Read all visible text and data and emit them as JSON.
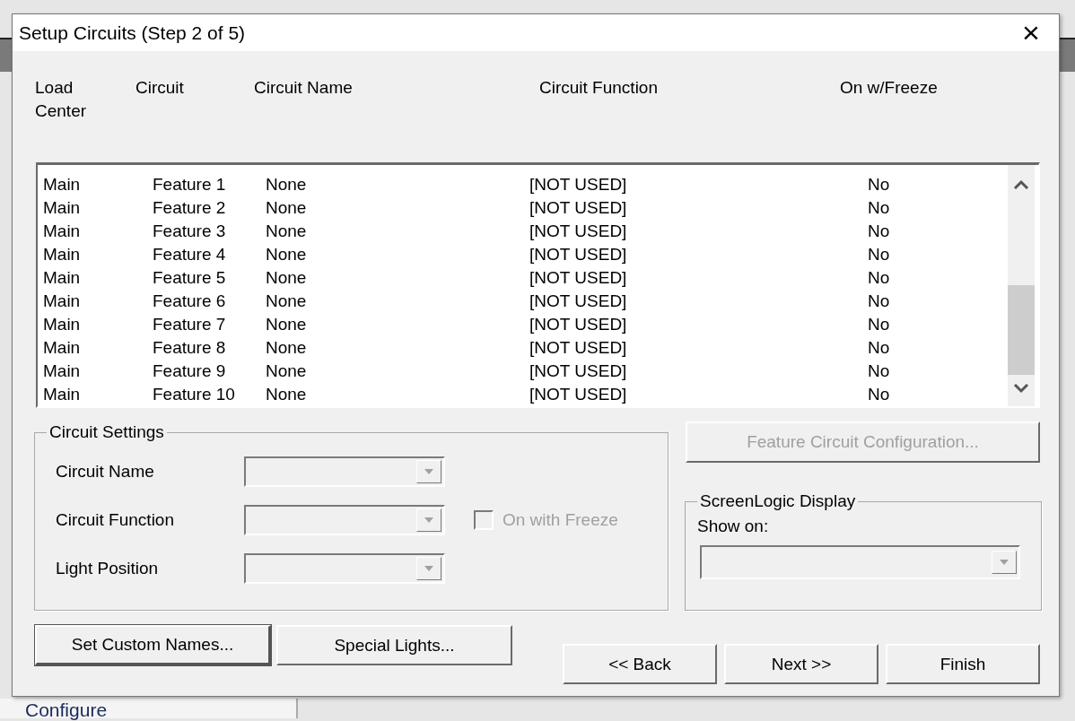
{
  "background": {
    "bottom_text": "Configure"
  },
  "dialog": {
    "title": "Setup Circuits (Step 2 of 5)",
    "close": "×"
  },
  "table": {
    "columns": [
      "Load\nCenter",
      "Circuit",
      "Circuit Name",
      "Circuit Function",
      "On w/Freeze"
    ],
    "rows": [
      [
        "Main",
        "Feature 1",
        "None",
        "[NOT USED]",
        "No"
      ],
      [
        "Main",
        "Feature 2",
        "None",
        "[NOT USED]",
        "No"
      ],
      [
        "Main",
        "Feature 3",
        "None",
        "[NOT USED]",
        "No"
      ],
      [
        "Main",
        "Feature 4",
        "None",
        "[NOT USED]",
        "No"
      ],
      [
        "Main",
        "Feature 5",
        "None",
        "[NOT USED]",
        "No"
      ],
      [
        "Main",
        "Feature 6",
        "None",
        "[NOT USED]",
        "No"
      ],
      [
        "Main",
        "Feature 7",
        "None",
        "[NOT USED]",
        "No"
      ],
      [
        "Main",
        "Feature 8",
        "None",
        "[NOT USED]",
        "No"
      ],
      [
        "Main",
        "Feature 9",
        "None",
        "[NOT USED]",
        "No"
      ],
      [
        "Main",
        "Feature 10",
        "None",
        "[NOT USED]",
        "No"
      ]
    ]
  },
  "circuit_settings": {
    "title": "Circuit Settings",
    "fields": [
      {
        "label": "Circuit Name",
        "disabled": true
      },
      {
        "label": "Circuit Function",
        "disabled": true
      },
      {
        "label": "Light Position",
        "disabled": true
      }
    ],
    "checkbox": {
      "label": "On with Freeze",
      "checked": false,
      "disabled": true
    }
  },
  "feature_button": {
    "label": "Feature Circuit Configuration...",
    "disabled": true
  },
  "screenlogic": {
    "title": "ScreenLogic Display",
    "show_on_label": "Show on:",
    "combo_disabled": true
  },
  "left_buttons": [
    {
      "label": "Set Custom Names...",
      "default": true
    },
    {
      "label": "Special Lights...",
      "default": false
    }
  ],
  "nav_buttons": [
    {
      "label": "<< Back",
      "disabled": false
    },
    {
      "label": "Next >>",
      "disabled": false
    },
    {
      "label": "Finish",
      "disabled": false
    }
  ]
}
